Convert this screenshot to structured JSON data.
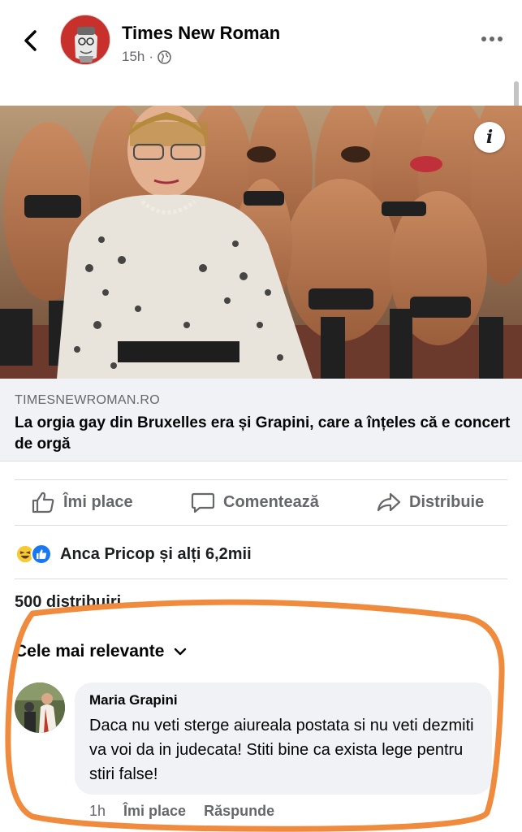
{
  "header": {
    "page_name": "Times New Roman",
    "timestamp": "15h",
    "separator": "·",
    "privacy_icon": "globe-icon",
    "back_icon": "chevron-left-icon",
    "more_icon": "more-dots-icon"
  },
  "link": {
    "domain": "TIMESNEWROMAN.RO",
    "title": "La orgia gay din Bruxelles era și Grapini, care a înțeles că e concert de orgă",
    "info_label": "i"
  },
  "actions": {
    "like": "Îmi place",
    "comment": "Comentează",
    "share": "Distribuie"
  },
  "reactions": {
    "summary": "Anca Pricop și alți 6,2mii",
    "emoji_icons": [
      "haha-reaction-icon",
      "like-reaction-icon"
    ]
  },
  "shares": {
    "text": "500 distribuiri"
  },
  "comments": {
    "sort_label": "Cele mai relevante",
    "items": [
      {
        "author": "Maria Grapini",
        "text": "Daca nu veti sterge aiureala postata si nu veti dezmiti va voi da in judecata! Stiti bine ca exista lege pentru stiri false!",
        "time": "1h",
        "like_label": "Îmi place",
        "reply_label": "Răspunde"
      }
    ]
  },
  "colors": {
    "text_secondary": "#65676b",
    "bubble_bg": "#f0f2f5",
    "highlight_ring": "#f08a3c",
    "like_blue": "#1877f2"
  }
}
